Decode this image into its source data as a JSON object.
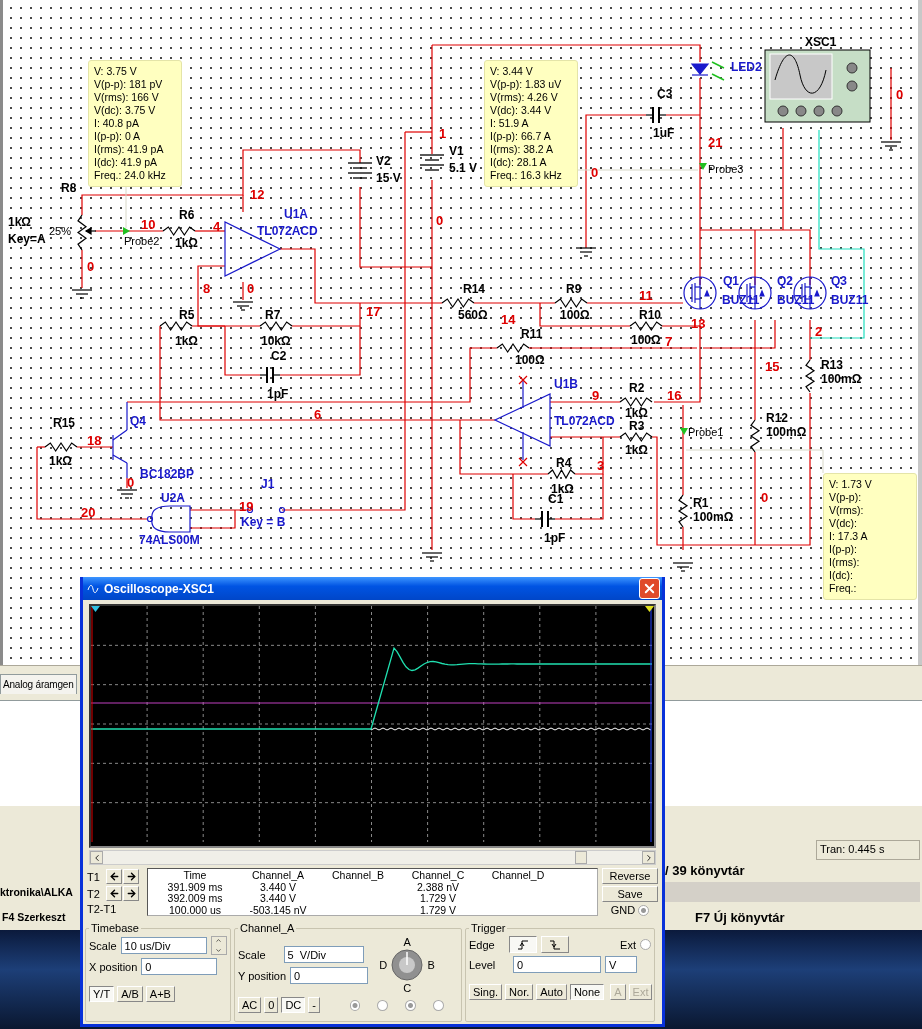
{
  "schematic": {
    "labels": [
      {
        "text": "R8",
        "kind": "ref"
      },
      {
        "text": "1kΩ",
        "kind": "ref"
      },
      {
        "text": "Key=A",
        "kind": "ref"
      },
      {
        "text": "25%",
        "kind": "small"
      },
      {
        "text": "R6",
        "kind": "ref"
      },
      {
        "text": "1kΩ",
        "kind": "ref"
      },
      {
        "text": "V2",
        "kind": "ref"
      },
      {
        "text": "15 V",
        "kind": "ref"
      },
      {
        "text": "V1",
        "kind": "ref"
      },
      {
        "text": "5.1 V",
        "kind": "ref"
      },
      {
        "text": "C3",
        "kind": "ref"
      },
      {
        "text": "1uF",
        "kind": "ref"
      },
      {
        "text": "XSC1",
        "kind": "ref"
      },
      {
        "text": "R14",
        "kind": "ref"
      },
      {
        "text": "560Ω",
        "kind": "ref"
      },
      {
        "text": "R9",
        "kind": "ref"
      },
      {
        "text": "100Ω",
        "kind": "ref"
      },
      {
        "text": "R11",
        "kind": "ref"
      },
      {
        "text": "100Ω",
        "kind": "ref"
      },
      {
        "text": "R10",
        "kind": "ref"
      },
      {
        "text": "100Ω",
        "kind": "ref"
      },
      {
        "text": "R5",
        "kind": "ref"
      },
      {
        "text": "1kΩ",
        "kind": "ref"
      },
      {
        "text": "R7",
        "kind": "ref"
      },
      {
        "text": "10kΩ",
        "kind": "ref"
      },
      {
        "text": "C2",
        "kind": "ref"
      },
      {
        "text": "1pF",
        "kind": "ref"
      },
      {
        "text": "R15",
        "kind": "ref"
      },
      {
        "text": "1kΩ",
        "kind": "ref"
      },
      {
        "text": "R2",
        "kind": "ref"
      },
      {
        "text": "1kΩ",
        "kind": "ref"
      },
      {
        "text": "R3",
        "kind": "ref"
      },
      {
        "text": "1kΩ",
        "kind": "ref"
      },
      {
        "text": "R4",
        "kind": "ref"
      },
      {
        "text": "1kΩ",
        "kind": "ref"
      },
      {
        "text": "C1",
        "kind": "ref"
      },
      {
        "text": "1pF",
        "kind": "ref"
      },
      {
        "text": "R1",
        "kind": "ref"
      },
      {
        "text": "100mΩ",
        "kind": "ref"
      },
      {
        "text": "R12",
        "kind": "ref"
      },
      {
        "text": "100mΩ",
        "kind": "ref"
      },
      {
        "text": "R13",
        "kind": "ref"
      },
      {
        "text": "100mΩ",
        "kind": "ref"
      },
      {
        "text": "U1A",
        "kind": "part"
      },
      {
        "text": "TL072ACD",
        "kind": "part"
      },
      {
        "text": "LED2",
        "kind": "part"
      },
      {
        "text": "Q1",
        "kind": "part"
      },
      {
        "text": "BUZ11",
        "kind": "part"
      },
      {
        "text": "Q2",
        "kind": "part"
      },
      {
        "text": "BUZ11",
        "kind": "part"
      },
      {
        "text": "Q3",
        "kind": "part"
      },
      {
        "text": "BUZ11",
        "kind": "part"
      },
      {
        "text": "U1B",
        "kind": "part"
      },
      {
        "text": "Q4",
        "kind": "part"
      },
      {
        "text": "TL072ACD",
        "kind": "part"
      },
      {
        "text": "BC182BP",
        "kind": "part"
      },
      {
        "text": "U2A",
        "kind": "part"
      },
      {
        "text": "74ALS00M",
        "kind": "part"
      },
      {
        "text": "J1",
        "kind": "part"
      },
      {
        "text": "Key = B",
        "kind": "part"
      },
      {
        "text": "12",
        "kind": "node"
      },
      {
        "text": "10",
        "kind": "node"
      },
      {
        "text": "4",
        "kind": "node"
      },
      {
        "text": "8",
        "kind": "node"
      },
      {
        "text": "0",
        "kind": "node"
      },
      {
        "text": "0",
        "kind": "node"
      },
      {
        "text": "1",
        "kind": "node"
      },
      {
        "text": "0",
        "kind": "node"
      },
      {
        "text": "0",
        "kind": "node"
      },
      {
        "text": "21",
        "kind": "node"
      },
      {
        "text": "0",
        "kind": "node"
      },
      {
        "text": "17",
        "kind": "node"
      },
      {
        "text": "14",
        "kind": "node"
      },
      {
        "text": "11",
        "kind": "node"
      },
      {
        "text": "13",
        "kind": "node"
      },
      {
        "text": "7",
        "kind": "node"
      },
      {
        "text": "2",
        "kind": "node"
      },
      {
        "text": "15",
        "kind": "node"
      },
      {
        "text": "6",
        "kind": "node"
      },
      {
        "text": "9",
        "kind": "node"
      },
      {
        "text": "16",
        "kind": "node"
      },
      {
        "text": "3",
        "kind": "node"
      },
      {
        "text": "0",
        "kind": "node"
      },
      {
        "text": "18",
        "kind": "node"
      },
      {
        "text": "0",
        "kind": "node"
      },
      {
        "text": "20",
        "kind": "node"
      },
      {
        "text": "19",
        "kind": "node"
      },
      {
        "text": "Probe2",
        "kind": "probe"
      },
      {
        "text": "Probe3",
        "kind": "probe"
      },
      {
        "text": "Probe1",
        "kind": "probe"
      }
    ]
  },
  "probes": [
    {
      "lines": [
        "V: 3.75 V",
        "V(p-p): 181 pV",
        "V(rms): 166 V",
        "V(dc): 3.75 V",
        "I: 40.8 pA",
        "I(p-p): 0 A",
        "I(rms): 41.9 pA",
        "I(dc): 41.9 pA",
        "Freq.: 24.0 kHz"
      ]
    },
    {
      "lines": [
        "V: 3.44 V",
        "V(p-p): 1.83 uV",
        "V(rms): 4.26 V",
        "V(dc): 3.44 V",
        "I: 51.9 A",
        "I(p-p): 66.7 A",
        "I(rms): 38.2 A",
        "I(dc): 28.1 A",
        "Freq.: 16.3 kHz"
      ]
    },
    {
      "lines": [
        "V: 1.73 V",
        "V(p-p):",
        "V(rms):",
        "V(dc):",
        "I: 17.3 A",
        "I(p-p):",
        "I(rms):",
        "I(dc):",
        "Freq.:"
      ]
    }
  ],
  "app": {
    "tab": "Analog áramgen",
    "status": "Tran: 0.445 s",
    "library_count": "/ 39 könyvtár",
    "path": "ktronika\\ALKA",
    "function_keys": [
      "F4 Szerkeszt",
      "F7 Új könyvtár"
    ]
  },
  "oscilloscope": {
    "title": "Oscilloscope-XSC1",
    "readout": {
      "columns": [
        "Time",
        "Channel_A",
        "Channel_B",
        "Channel_C",
        "Channel_D"
      ],
      "rows": [
        {
          "label": "T1",
          "kind": "cursor",
          "time": "391.909 ms",
          "channel_a": "3.440 V",
          "channel_c": "2.388 nV"
        },
        {
          "label": "T2",
          "kind": "cursor",
          "time": "392.009 ms",
          "channel_a": "3.440 V",
          "channel_c": "1.729 V"
        },
        {
          "label": "T2-T1",
          "kind": "difference",
          "time": "100.000 us",
          "channel_a": "-503.145 nV",
          "channel_c": "1.729 V"
        }
      ]
    },
    "buttons": [
      "Reverse",
      "Save"
    ],
    "gnd": {
      "label": "GND",
      "checked": true
    },
    "timebase": {
      "title": "Timebase",
      "scale_label": "Scale",
      "scale": "10 us/Div",
      "xpos_label": "X position",
      "xpos": "0",
      "modes": [
        {
          "label": "Y/T",
          "selected": true
        },
        {
          "label": "A/B",
          "selected": false
        },
        {
          "label": "A+B",
          "selected": false
        }
      ]
    },
    "channel": {
      "title": "Channel_A",
      "scale_label": "Scale",
      "scale": "5  V/Div",
      "ypos_label": "Y position",
      "ypos": "0",
      "knob_labels": [
        "A",
        "B",
        "C",
        "D"
      ],
      "coupling": [
        {
          "label": "AC",
          "selected": false
        },
        {
          "label": "0",
          "selected": false
        },
        {
          "label": "DC",
          "selected": true
        },
        {
          "label": "-",
          "selected": false
        }
      ],
      "radios": [
        {
          "checked": true
        },
        {
          "checked": false
        },
        {
          "checked": true
        },
        {
          "checked": false
        }
      ]
    },
    "trigger": {
      "title": "Trigger",
      "edge_label": "Edge",
      "edges": [
        {
          "kind": "rising",
          "selected": true
        },
        {
          "kind": "falling",
          "selected": false
        }
      ],
      "ext": {
        "label": "Ext",
        "checked": false
      },
      "level_label": "Level",
      "level_value": "0",
      "unit": "V",
      "modes": [
        {
          "label": "Sing.",
          "selected": false
        },
        {
          "label": "Nor.",
          "selected": false
        },
        {
          "label": "Auto",
          "selected": false
        },
        {
          "label": "None",
          "selected": true
        }
      ],
      "sources": [
        {
          "label": "A",
          "disabled": true
        },
        {
          "label": "Ext",
          "disabled": true
        }
      ]
    }
  }
}
